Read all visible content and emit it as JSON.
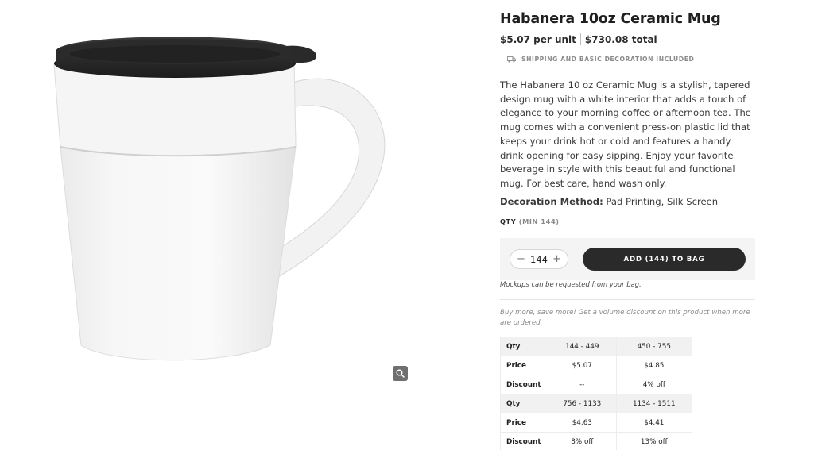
{
  "product": {
    "title": "Habanera 10oz Ceramic Mug",
    "unit_price": "$5.07 per unit",
    "total_price": "$730.08 total",
    "shipping_note": "SHIPPING AND BASIC DECORATION INCLUDED",
    "description": "The Habanera 10 oz Ceramic Mug is a stylish, tapered design mug with a white interior that adds a touch of elegance to your morning coffee or afternoon tea. The mug comes with a convenient press-on plastic lid that keeps your drink hot or cold and features a handy drink opening for easy sipping. Enjoy your favorite beverage in style with this beautiful and functional mug. For best care, hand wash only.",
    "decoration_label": "Decoration Method:",
    "decoration_value": "Pad Printing, Silk Screen"
  },
  "quantity": {
    "label": "QTY",
    "min_note": "(MIN 144)",
    "value": "144",
    "minus_symbol": "−",
    "plus_symbol": "+",
    "add_button_label": "ADD (144) TO BAG"
  },
  "notes": {
    "mockup": "Mockups can be requested from your bag.",
    "volume": "Buy more, save more! Get a volume discount on this product when more are ordered."
  },
  "pricing_table": [
    {
      "qty_label": "Qty",
      "price_label": "Price",
      "discount_label": "Discount",
      "tiers": [
        {
          "qty": "144 - 449",
          "price": "$5.07",
          "discount": "--"
        },
        {
          "qty": "450 - 755",
          "price": "$4.85",
          "discount": "4% off"
        }
      ]
    },
    {
      "qty_label": "Qty",
      "price_label": "Price",
      "discount_label": "Discount",
      "tiers": [
        {
          "qty": "756 - 1133",
          "price": "$4.63",
          "discount": "8% off"
        },
        {
          "qty": "1134 - 1511",
          "price": "$4.41",
          "discount": "13% off"
        }
      ]
    }
  ],
  "icons": {
    "zoom": "magnifier-icon",
    "shipping": "truck-icon"
  },
  "colors": {
    "button_dark": "#2a2a2a",
    "panel_bg": "#f4f4f4",
    "table_shade": "#f1f1f1"
  }
}
